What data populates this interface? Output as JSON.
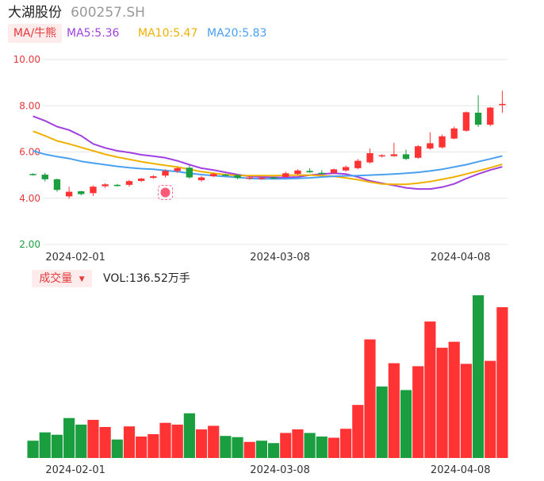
{
  "header": {
    "stock_name": "大湖股份",
    "stock_code": "600257.SH"
  },
  "indicators": {
    "ma_label": "MA/牛熊",
    "ma5": "MA5:5.36",
    "ma10": "MA10:5.47",
    "ma20": "MA20:5.83"
  },
  "volume_panel": {
    "label": "成交量",
    "value": "VOL:136.52万手"
  },
  "colors": {
    "up": "#ff3333",
    "down": "#1a9e3f",
    "ma5": "#a040e0",
    "ma10": "#f0b000",
    "ma20": "#4aa0f0",
    "grid": "#e6e6e6",
    "price_tick": "#e5383b",
    "min_tick": "#1a9e3f"
  },
  "chart_data": [
    {
      "type": "candlestick",
      "y_ticks": [
        "10.00",
        "8.00",
        "6.00",
        "4.00",
        "2.00"
      ],
      "ylim": [
        2,
        10
      ],
      "x_tick_labels": [
        "2024-02-01",
        "2024-03-08",
        "2024-04-08"
      ],
      "x_tick_index": [
        3,
        20,
        35
      ],
      "ohlc": [
        [
          5.05,
          5.08,
          4.98,
          5.02
        ],
        [
          5.02,
          5.1,
          4.72,
          4.82
        ],
        [
          4.82,
          4.85,
          4.28,
          4.36
        ],
        [
          4.08,
          4.5,
          3.98,
          4.28
        ],
        [
          4.3,
          4.32,
          4.12,
          4.18
        ],
        [
          4.22,
          4.55,
          4.1,
          4.5
        ],
        [
          4.52,
          4.65,
          4.45,
          4.6
        ],
        [
          4.58,
          4.62,
          4.5,
          4.56
        ],
        [
          4.58,
          4.8,
          4.5,
          4.74
        ],
        [
          4.75,
          4.88,
          4.7,
          4.85
        ],
        [
          4.88,
          5.0,
          4.84,
          4.95
        ],
        [
          4.98,
          5.25,
          4.9,
          5.18
        ],
        [
          5.18,
          5.35,
          5.1,
          5.3
        ],
        [
          5.32,
          5.42,
          4.85,
          4.9
        ],
        [
          4.78,
          4.96,
          4.72,
          4.9
        ],
        [
          4.95,
          5.1,
          4.92,
          5.05
        ],
        [
          5.02,
          5.06,
          4.98,
          5.0
        ],
        [
          5.0,
          5.02,
          4.82,
          4.88
        ],
        [
          4.86,
          4.92,
          4.8,
          4.9
        ],
        [
          4.85,
          4.92,
          4.8,
          4.88
        ],
        [
          4.9,
          4.94,
          4.82,
          4.86
        ],
        [
          4.92,
          5.15,
          4.9,
          5.08
        ],
        [
          5.05,
          5.25,
          5.0,
          5.2
        ],
        [
          5.18,
          5.3,
          5.1,
          5.12
        ],
        [
          5.1,
          5.22,
          5.05,
          5.08
        ],
        [
          5.1,
          5.28,
          5.05,
          5.25
        ],
        [
          5.2,
          5.42,
          5.15,
          5.35
        ],
        [
          5.3,
          5.7,
          5.25,
          5.62
        ],
        [
          5.55,
          6.15,
          5.5,
          5.95
        ],
        [
          5.82,
          5.9,
          5.76,
          5.86
        ],
        [
          5.82,
          6.4,
          5.8,
          5.9
        ],
        [
          5.9,
          6.1,
          5.65,
          5.7
        ],
        [
          5.75,
          6.3,
          5.7,
          6.25
        ],
        [
          6.15,
          6.85,
          6.1,
          6.38
        ],
        [
          6.2,
          6.75,
          6.15,
          6.68
        ],
        [
          6.58,
          7.1,
          6.55,
          7.02
        ],
        [
          6.92,
          7.75,
          6.88,
          7.72
        ],
        [
          7.7,
          8.45,
          7.08,
          7.18
        ],
        [
          7.18,
          7.95,
          7.12,
          7.92
        ],
        [
          8.05,
          8.65,
          7.7,
          8.08
        ]
      ],
      "ma_series": [
        {
          "name": "MA5",
          "values": [
            7.55,
            7.35,
            7.1,
            6.95,
            6.7,
            6.35,
            6.18,
            6.05,
            5.98,
            5.88,
            5.82,
            5.75,
            5.62,
            5.45,
            5.3,
            5.22,
            5.12,
            5.02,
            4.95,
            4.92,
            4.9,
            4.9,
            4.92,
            5.0,
            5.05,
            5.08,
            5.05,
            4.92,
            4.75,
            4.65,
            4.55,
            4.45,
            4.4,
            4.4,
            4.48,
            4.62,
            4.85,
            5.05,
            5.22,
            5.36
          ]
        },
        {
          "name": "MA10",
          "values": [
            6.9,
            6.7,
            6.48,
            6.35,
            6.2,
            6.05,
            5.9,
            5.78,
            5.68,
            5.58,
            5.5,
            5.42,
            5.35,
            5.25,
            5.15,
            5.08,
            5.02,
            4.98,
            4.98,
            4.98,
            4.98,
            4.99,
            5.0,
            5.0,
            4.98,
            4.95,
            4.88,
            4.8,
            4.7,
            4.62,
            4.6,
            4.6,
            4.65,
            4.72,
            4.82,
            4.92,
            5.05,
            5.18,
            5.32,
            5.47
          ]
        },
        {
          "name": "MA20",
          "values": [
            6.05,
            5.9,
            5.8,
            5.72,
            5.6,
            5.52,
            5.45,
            5.38,
            5.32,
            5.28,
            5.25,
            5.2,
            5.15,
            5.08,
            5.02,
            4.98,
            4.94,
            4.9,
            4.86,
            4.84,
            4.84,
            4.84,
            4.86,
            4.88,
            4.92,
            4.95,
            4.97,
            4.98,
            5.0,
            5.02,
            5.05,
            5.08,
            5.12,
            5.18,
            5.25,
            5.35,
            5.45,
            5.58,
            5.7,
            5.83
          ]
        }
      ]
    },
    {
      "type": "bar",
      "title": "成交量",
      "x_tick_labels": [
        "2024-02-01",
        "2024-03-08",
        "2024-04-08"
      ],
      "x_tick_index": [
        3,
        20,
        35
      ],
      "ylim": [
        0,
        136.52
      ],
      "values": [
        14.5,
        21.5,
        19.5,
        33.5,
        28.0,
        32.0,
        26.0,
        15.5,
        26.5,
        18.0,
        20.0,
        29.5,
        28.0,
        37.5,
        24.0,
        27.0,
        18.5,
        17.5,
        13.5,
        14.5,
        12.5,
        21.0,
        24.0,
        21.0,
        18.0,
        17.0,
        24.5,
        44.5,
        99.5,
        60.0,
        79.5,
        57.0,
        77.0,
        114.5,
        92.5,
        97.5,
        79.0,
        136.5,
        81.5,
        126.5
      ],
      "direction": [
        "down",
        "down",
        "down",
        "down",
        "down",
        "up",
        "up",
        "down",
        "up",
        "up",
        "up",
        "up",
        "up",
        "down",
        "up",
        "up",
        "down",
        "down",
        "up",
        "down",
        "down",
        "up",
        "up",
        "down",
        "down",
        "up",
        "up",
        "up",
        "up",
        "down",
        "up",
        "down",
        "up",
        "up",
        "up",
        "up",
        "up",
        "down",
        "up",
        "up"
      ]
    }
  ]
}
